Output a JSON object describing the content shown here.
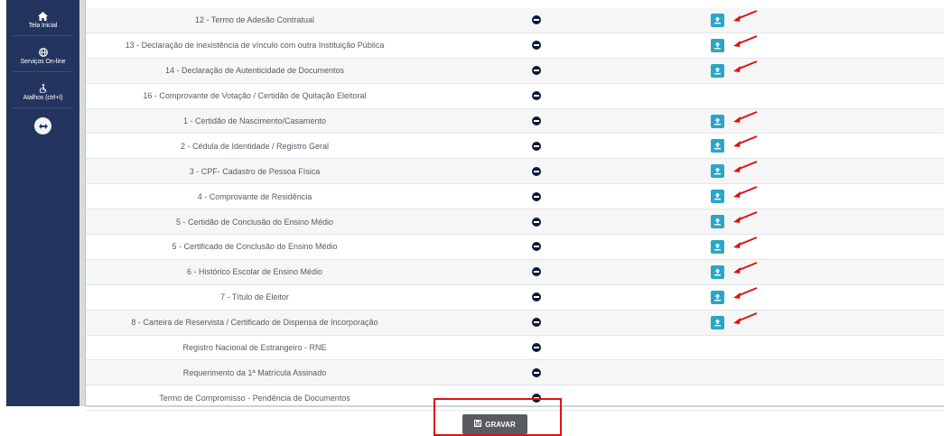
{
  "sidebar": {
    "items": [
      {
        "label": "Tela Inicial",
        "icon": "home-icon"
      },
      {
        "label": "Serviços On-line",
        "icon": "globe-icon"
      },
      {
        "label": "Atalhos (ctrl+I)",
        "icon": "accessibility-icon"
      }
    ],
    "toggle_icon": "expand-arrows-icon"
  },
  "documents": [
    {
      "name": "12 - Termo de Adesão Contratual",
      "upload": true
    },
    {
      "name": "13 - Declaração de inexistência de vínculo com outra Instituição Pública",
      "upload": true
    },
    {
      "name": "14 - Declaração de Autenticidade de Documentos",
      "upload": true
    },
    {
      "name": "16 - Comprovante de Votação / Certidão de Quitação Eleitoral",
      "upload": false
    },
    {
      "name": "1 - Certidão de Nascimento/Casamento",
      "upload": true
    },
    {
      "name": "2 - Cédula de Identidade / Registro Geral",
      "upload": true
    },
    {
      "name": "3 - CPF- Cadastro de Pessoa Física",
      "upload": true
    },
    {
      "name": "4 - Comprovante de Residência",
      "upload": true
    },
    {
      "name": "5 - Certidão de Conclusão do Ensino Médio",
      "upload": true
    },
    {
      "name": "5 - Certificado de Conclusão do Ensino Médio",
      "upload": true
    },
    {
      "name": "6 - Histórico Escolar de Ensino Médio",
      "upload": true
    },
    {
      "name": "7 - Título de Eleitor",
      "upload": true
    },
    {
      "name": "8 - Carteira de Reservista / Certificado de Dispensa de Incorporação",
      "upload": true
    },
    {
      "name": "Registro Nacional de Estrangeiro - RNE",
      "upload": false
    },
    {
      "name": "Requerimento da 1ª Matrícula Assinado",
      "upload": false
    },
    {
      "name": "Termo de Compromisso - Pendência de Documentos",
      "upload": false
    }
  ],
  "footer": {
    "save_label": "GRAVAR",
    "save_icon": "floppy-disk-icon"
  },
  "colors": {
    "sidebar": "#23355f",
    "upload_button": "#2ba6c6",
    "status_icon": "#0b1a3a",
    "annotation": "#e01010",
    "save_button": "#585c60"
  }
}
